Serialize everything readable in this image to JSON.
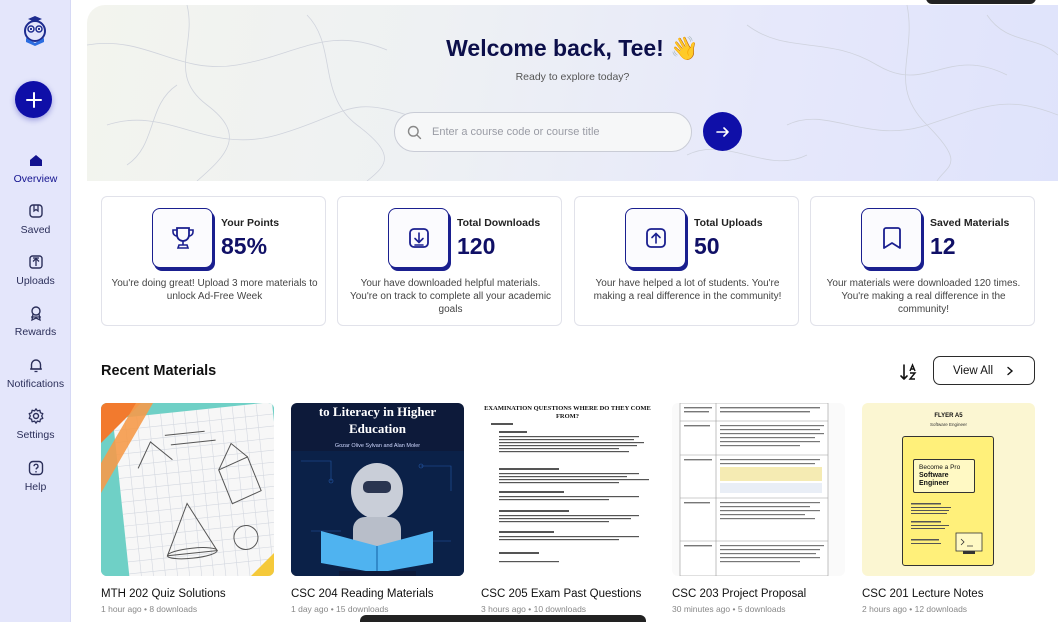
{
  "sidebar": {
    "logo_icon": "owl-book-icon",
    "add_icon": "plus-icon",
    "items": [
      {
        "label": "Overview",
        "icon": "home-icon",
        "active": true
      },
      {
        "label": "Saved",
        "icon": "bookmark-icon",
        "active": false
      },
      {
        "label": "Uploads",
        "icon": "upload-icon",
        "active": false
      },
      {
        "label": "Rewards",
        "icon": "award-icon",
        "active": false
      },
      {
        "label": "Notifications",
        "icon": "bell-icon",
        "active": false
      },
      {
        "label": "Settings",
        "icon": "gear-icon",
        "active": false
      },
      {
        "label": "Help",
        "icon": "help-icon",
        "active": false
      }
    ]
  },
  "hero": {
    "title": "Welcome back, Tee! 👋",
    "subtitle": "Ready to explore today?",
    "search_placeholder": "Enter a course code or course title"
  },
  "stats": [
    {
      "label": "Your Points",
      "value": "85%",
      "icon": "trophy-icon",
      "desc": "You're doing great! Upload 3 more materials to unlock Ad-Free Week"
    },
    {
      "label": "Total Downloads",
      "value": "120",
      "icon": "download-icon",
      "desc": "Your have downloaded helpful materials. You're on track to complete all your academic goals"
    },
    {
      "label": "Total Uploads",
      "value": "50",
      "icon": "upload-icon",
      "desc": "Your have helped a lot of students. You're making a real difference in the community!"
    },
    {
      "label": "Saved Materials",
      "value": "12",
      "icon": "bookmark-icon",
      "desc": "Your materials were downloaded 120 times. You're making a real difference in the community!"
    }
  ],
  "recent": {
    "title": "Recent Materials",
    "view_all": "View All",
    "sort_icon": "sort-az-icon",
    "items": [
      {
        "title": "MTH 202 Quiz Solutions",
        "meta": "1 hour ago • 8 downloads"
      },
      {
        "title": "CSC 204 Reading Materials",
        "meta": "1 day ago • 15 downloads",
        "thumb_heading": "to Literacy in Higher Education",
        "thumb_authors": "Gozar Olive Sylvan and Alan Moler"
      },
      {
        "title": "CSC 205 Exam Past Questions",
        "meta": "3 hours ago • 10 downloads",
        "thumb_heading": "EXAMINATION QUESTIONS WHERE DO THEY COME FROM?"
      },
      {
        "title": "CSC 203 Project Proposal",
        "meta": "30 minutes ago • 5 downloads"
      },
      {
        "title": "CSC 201 Lecture Notes",
        "meta": "2 hours ago • 12 downloads",
        "thumb_heading": "FLYER A5",
        "thumb_sub": "Software Engineer",
        "thumb_banner": "Become a Pro",
        "thumb_banner2": "Software Engineer"
      }
    ]
  },
  "colors": {
    "primary": "#0f0fa8",
    "sidebar_bg": "#e4e6fb",
    "navy": "#101066"
  }
}
